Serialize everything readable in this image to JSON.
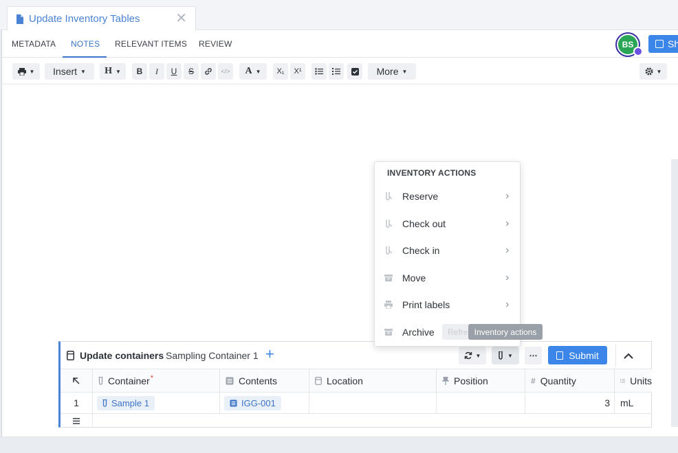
{
  "document_tab": {
    "title": "Update Inventory Tables",
    "close": "✕"
  },
  "subtabs": [
    {
      "label": "METADATA"
    },
    {
      "label": "NOTES"
    },
    {
      "label": "RELEVANT ITEMS"
    },
    {
      "label": "REVIEW"
    }
  ],
  "active_subtab": "NOTES",
  "user": {
    "initials": "BS"
  },
  "share_label": "Sh",
  "toolbar": {
    "insert_label": "Insert",
    "heading_label": "H",
    "bold": "B",
    "italic": "I",
    "underline": "U",
    "strike": "S",
    "code": "</>",
    "font_color": "A",
    "subscript": "X₁",
    "superscript": "X¹",
    "more_label": "More"
  },
  "inventory_menu": {
    "heading": "INVENTORY ACTIONS",
    "items": [
      {
        "label": "Reserve",
        "icon": "tube-icon"
      },
      {
        "label": "Check out",
        "icon": "tube-icon"
      },
      {
        "label": "Check in",
        "icon": "tube-icon"
      },
      {
        "label": "Move",
        "icon": "archive-box-icon"
      },
      {
        "label": "Print labels",
        "icon": "printer-icon"
      },
      {
        "label": "Archive",
        "icon": "archive-box-icon"
      }
    ]
  },
  "tooltip": {
    "label": "Inventory actions",
    "faded_label": "Refre"
  },
  "inventory_table": {
    "title": "Update containers",
    "subtitle": "Sampling Container 1",
    "add": "+",
    "submit_label": "Submit",
    "columns": [
      {
        "label": "Container",
        "required": "*"
      },
      {
        "label": "Contents"
      },
      {
        "label": "Location"
      },
      {
        "label": "Position"
      },
      {
        "label": "Quantity"
      },
      {
        "label": "Units"
      }
    ],
    "rows": [
      {
        "num": "1",
        "container": "Sample 1",
        "contents": "IGG-001",
        "location": "",
        "position": "",
        "quantity": "3",
        "units": "mL"
      }
    ]
  },
  "colors": {
    "accent": "#3b86e8",
    "avatar": "#2aa556",
    "link": "#4a83d4"
  }
}
